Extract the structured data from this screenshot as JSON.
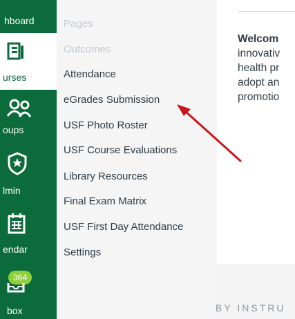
{
  "global_nav": {
    "dashboard_label": "hboard",
    "courses_label": "urses",
    "groups_label": "oups",
    "admin_label": "lmin",
    "calendar_label": "endar",
    "inbox_label": "box",
    "inbox_badge": "364"
  },
  "course_nav": {
    "items": [
      {
        "label": "Pages",
        "disabled": true
      },
      {
        "label": "Outcomes",
        "disabled": true
      },
      {
        "label": "Attendance",
        "disabled": false
      },
      {
        "label": "eGrades Submission",
        "disabled": false
      },
      {
        "label": "USF Photo Roster",
        "disabled": false
      },
      {
        "label": "USF Course Evaluations",
        "disabled": false
      },
      {
        "label": "Library Resources",
        "disabled": false
      },
      {
        "label": "Final Exam Matrix",
        "disabled": false
      },
      {
        "label": "USF First Day Attendance",
        "disabled": false
      },
      {
        "label": "Settings",
        "disabled": false
      }
    ]
  },
  "content": {
    "welcome_bold": "Welcom",
    "welcome_lines": "innovativ\nhealth pr\nadopt an\npromotio"
  },
  "footer": {
    "text": "BY INSTRU"
  },
  "colors": {
    "brand_green": "#0b6b3a",
    "badge_green": "#8fcf3c",
    "arrow_red": "#c8161d",
    "text_dark": "#2d3b45",
    "text_disabled": "#c6cbd0"
  }
}
